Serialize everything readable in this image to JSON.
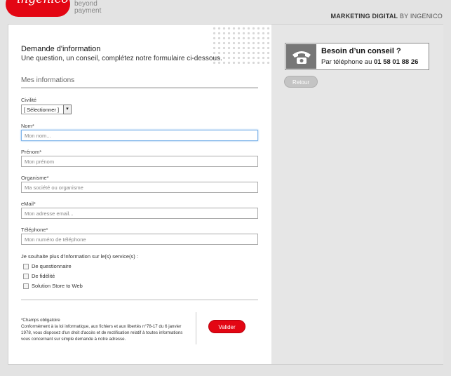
{
  "header": {
    "logo": "ingenico",
    "tagline": "beyond payment",
    "brand_prefix": "MARKETING DIGITAL",
    "brand_suffix": " BY INGENICO"
  },
  "form": {
    "title": "Demande d'information",
    "subtitle": "Une question, un conseil, complétez notre formulaire ci-dessous.",
    "section": "Mes informations",
    "civilite": {
      "label": "Civilité",
      "selected": "[ Sélectionner ]"
    },
    "nom": {
      "label": "Nom*",
      "placeholder": "Mon nom..."
    },
    "prenom": {
      "label": "Prénom*",
      "placeholder": "Mon prénom"
    },
    "organisme": {
      "label": "Organisme*",
      "placeholder": "Ma société ou organisme"
    },
    "email": {
      "label": "eMail*",
      "placeholder": "Mon adresse email..."
    },
    "telephone": {
      "label": "Téléphone*",
      "placeholder": "Mon numéro de téléphone"
    },
    "services_question": "Je souhaite plus d'information sur le(s) service(s) :",
    "services": [
      "De questionnaire",
      "De fidélité",
      "Solution Store to Web"
    ],
    "required_note": "*Champs obligatoire",
    "legal_text": "Conformément à la loi informatique, aux fichiers et aux libertés n°78-17 du 6 janvier 1978, vous disposez d'un droit d'accès et de rectification relatif à toutes informations vous concernant sur simple demande à notre adresse.",
    "submit_label": "Valider"
  },
  "sidebar": {
    "title": "Besoin d’un conseil ?",
    "phone_prefix": "Par téléphone au ",
    "phone_number": "01 58 01 88 26",
    "back_label": "Retour"
  },
  "colors": {
    "brand_red": "#e30613",
    "panel_grey": "#e6e6e6"
  }
}
